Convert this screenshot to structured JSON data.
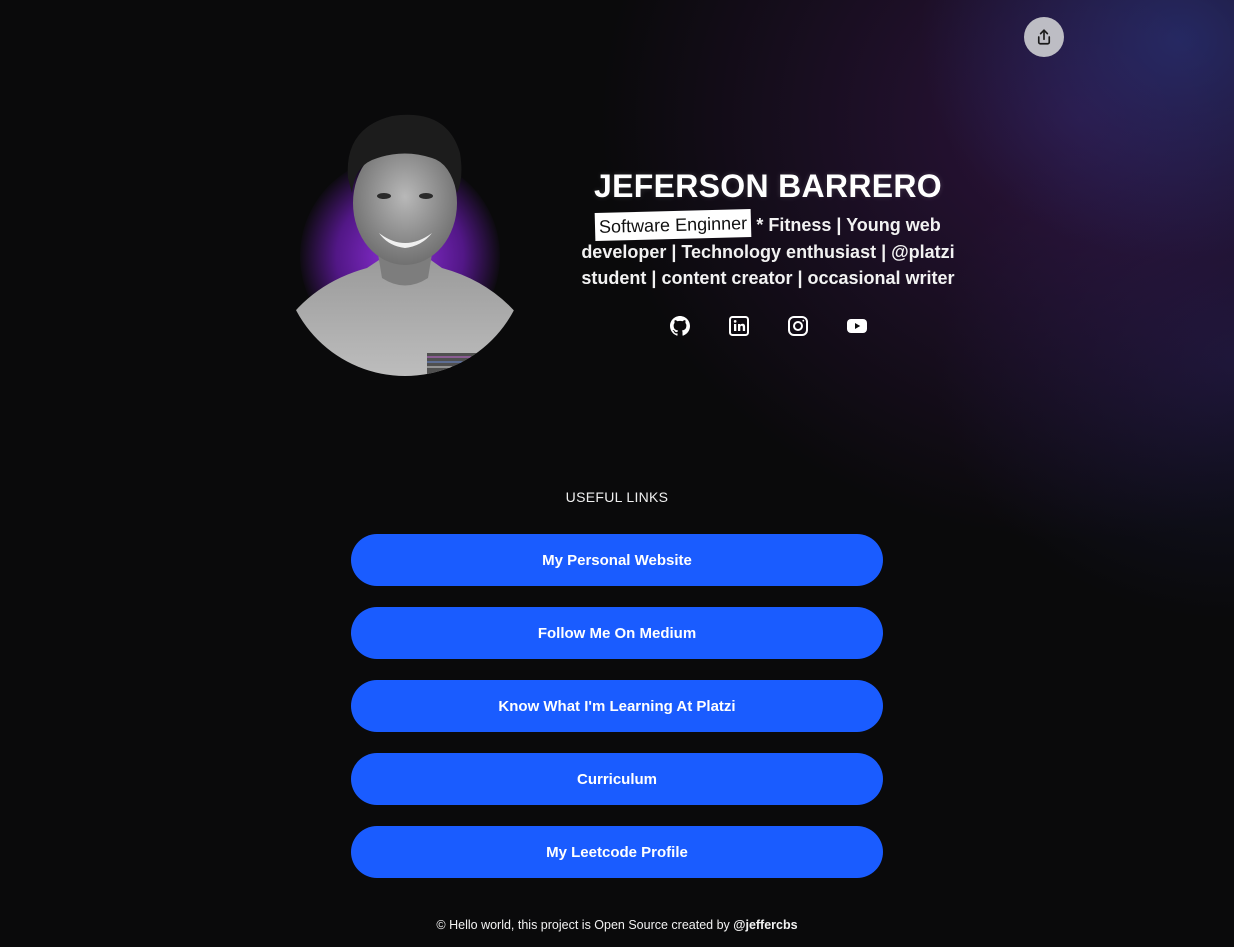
{
  "colors": {
    "background": "#0a0a0b",
    "accent_button": "#1a5cff",
    "glow_purple": "#8a2be2",
    "share_button": "#bdbdc4"
  },
  "share": {
    "icon": "share-icon"
  },
  "profile": {
    "name": "JEFERSON BARRERO",
    "bio_highlight": "Software Enginner",
    "bio_rest": " * Fitness | Young web developer | Technology enthusiast | @platzi student | content creator | occasional writer"
  },
  "socials": [
    {
      "name": "github",
      "icon": "github-icon"
    },
    {
      "name": "linkedin",
      "icon": "linkedin-icon"
    },
    {
      "name": "instagram",
      "icon": "instagram-icon"
    },
    {
      "name": "youtube",
      "icon": "youtube-icon"
    }
  ],
  "links_section": {
    "heading": "USEFUL LINKS",
    "links": [
      {
        "label": "My Personal Website"
      },
      {
        "label": "Follow Me On Medium"
      },
      {
        "label": "Know What I'm Learning At Platzi"
      },
      {
        "label": "Curriculum"
      },
      {
        "label": "My Leetcode Profile"
      }
    ]
  },
  "footer": {
    "text": "© Hello world, this project is Open Source created by ",
    "handle": "@jeffercbs"
  }
}
